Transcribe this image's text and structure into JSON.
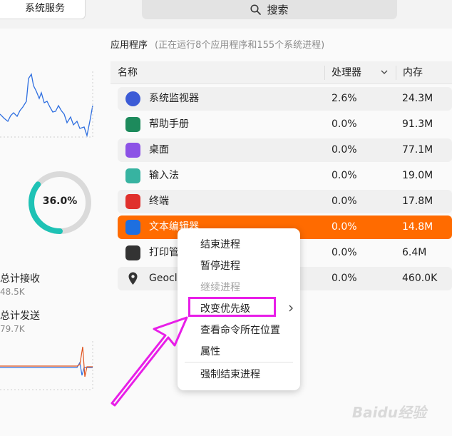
{
  "tabs": {
    "system_services": "系统服务"
  },
  "search": {
    "label": "搜索"
  },
  "summary": {
    "title": "应用程序",
    "subtitle": "(正在运行8个应用程序和155个系统进程)"
  },
  "table": {
    "headers": {
      "name": "名称",
      "cpu": "处理器",
      "memory": "内存"
    },
    "rows": [
      {
        "name": "系统监视器",
        "cpu": "2.6%",
        "memory": "24.3M",
        "icon": "system-monitor-icon",
        "color": "#3c5bd6"
      },
      {
        "name": "帮助手册",
        "cpu": "0.0%",
        "memory": "91.3M",
        "icon": "help-manual-icon",
        "color": "#1d8a5c"
      },
      {
        "name": "桌面",
        "cpu": "0.0%",
        "memory": "77.1M",
        "icon": "desktop-icon",
        "color": "#8c52e6"
      },
      {
        "name": "输入法",
        "cpu": "0.0%",
        "memory": "19.0M",
        "icon": "input-method-icon",
        "color": "#37b3a1"
      },
      {
        "name": "终端",
        "cpu": "0.0%",
        "memory": "17.8M",
        "icon": "terminal-icon",
        "color": "#e0302c"
      },
      {
        "name": "文本编辑器",
        "cpu": "0.0%",
        "memory": "14.8M",
        "icon": "text-editor-icon",
        "color": "#1e6fe0"
      },
      {
        "name": "打印管",
        "cpu": "0.0%",
        "memory": "6.4M",
        "icon": "printer-icon",
        "color": "#333333"
      },
      {
        "name": "Geoclu",
        "cpu": "0.0%",
        "memory": "460.0K",
        "icon": "location-pin-icon",
        "color": "#333333"
      }
    ]
  },
  "left": {
    "cpu_usage": "36.0%",
    "cpu_fraction": 0.36,
    "net_recv_label": "总计接收",
    "net_recv_value": "48.5K",
    "net_send_label": "总计发送",
    "net_send_value": "79.7K"
  },
  "context_menu": {
    "items": [
      {
        "label": "结束进程",
        "enabled": true
      },
      {
        "label": "暂停进程",
        "enabled": true
      },
      {
        "label": "继续进程",
        "enabled": false
      },
      {
        "label": "改变优先级",
        "enabled": true,
        "submenu": true
      },
      {
        "label": "查看命令所在位置",
        "enabled": true
      },
      {
        "label": "属性",
        "enabled": true
      },
      {
        "label": "强制结束进程",
        "enabled": true
      }
    ]
  },
  "watermark": "Baidu经验",
  "colors": {
    "accent": "#ff6b00",
    "cpu_ring": "#1ec2b5",
    "annotation": "#e81ee8"
  }
}
